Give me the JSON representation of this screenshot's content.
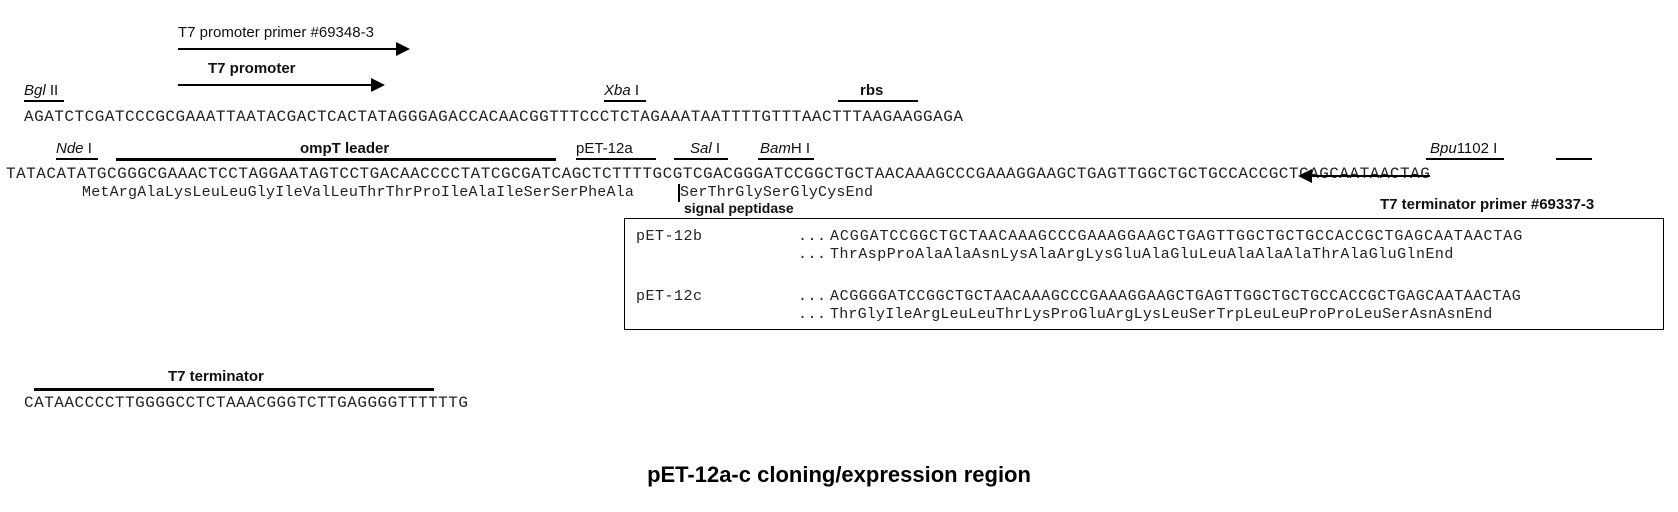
{
  "labels": {
    "t7_primer": "T7 promoter primer #69348-3",
    "t7_promoter": "T7 promoter",
    "bgl2": "Bgl",
    "bgl2_suf": " II",
    "xba1": "Xba",
    "xba1_suf": " I",
    "rbs": "rbs",
    "nde1": "Nde",
    "nde1_suf": " I",
    "ompt": "ompT leader",
    "pet12a": "pET-12a",
    "sal1": "Sal",
    "sal1_suf": " I",
    "bamh1": "Bam",
    "bamh1_mid": "H",
    "bamh1_suf": " I",
    "bpu1102": "Bpu",
    "bpu1102_suf": "1102 I",
    "signal_peptidase": "signal peptidase",
    "t7_term_primer": "T7 terminator primer #69337-3",
    "t7_terminator": "T7 terminator",
    "pet12b": "pET-12b",
    "pet12c": "pET-12c",
    "dots": "..."
  },
  "caption": "pET-12a-c cloning/expression region",
  "sequences": {
    "line1": "AGATCTCGATCCCGCGAAATTAATACGACTCACTATAGGGAGACCACAACGGTTTCCCTCTAGAAATAATTTTGTTTAACTTTAAGAAGGAGA",
    "line2": "TATACATATGCGGGCGAAACTCCTAGGAATAGTCCTGACAACCCCTATCGCGATCAGCTCTTTTGCGTCGACGGGATCCGGCTGCTAACAAAGCCCGAAAGGAAGCTGAGTTGGCTGCTGCCACCGCTGAGCAATAACTAG",
    "line2_prot_pre": "MetArgAlaLysLeuLeuGlyIleValLeuThrThrProIleAlaIleSerSerPheAla",
    "line2_prot_post": "SerThrGlySerGlyCysEnd",
    "line3": "CATAACCCCTTGGGGCCTCTAAACGGGTCTTGAGGGGTTTTTTG",
    "pet12b_dna": "ACGGATCCGGCTGCTAACAAAGCCCGAAAGGAAGCTGAGTTGGCTGCTGCCACCGCTGAGCAATAACTAG",
    "pet12b_prot": "ThrAspProAlaAlaAsnLysAlaArgLysGluAlaGluLeuAlaAlaAlaThrAlaGluGlnEnd",
    "pet12c_dna": "ACGGGGATCCGGCTGCTAACAAAGCCCGAAAGGAAGCTGAGTTGGCTGCTGCCACCGCTGAGCAATAACTAG",
    "pet12c_prot": "ThrGlyIleArgLeuLeuThrLysProGluArgLysLeuSerTrpLeuLeuProProLeuSerAsnAsnEnd"
  }
}
